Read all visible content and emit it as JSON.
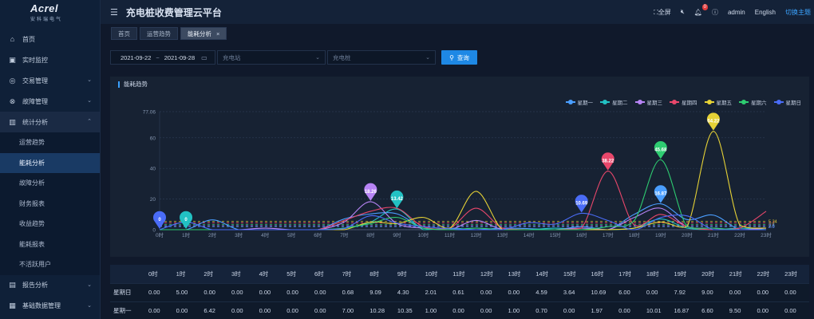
{
  "sidebar": {
    "logo_brand": "Acrel",
    "logo_sub": "安科瑞电气",
    "items": [
      {
        "label": "首页",
        "icon": "home-icon"
      },
      {
        "label": "实时监控",
        "icon": "monitor-icon"
      },
      {
        "label": "交易管理",
        "icon": "trade-icon"
      },
      {
        "label": "故障管理",
        "icon": "fault-icon"
      },
      {
        "label": "统计分析",
        "icon": "stats-icon"
      }
    ],
    "sub_items": [
      "运营趋势",
      "能耗分析",
      "故障分析",
      "财务报表",
      "收益趋势",
      "能耗报表",
      "不活跃用户"
    ],
    "bottom_items": [
      {
        "label": "报告分析",
        "icon": "report-icon"
      },
      {
        "label": "基础数据管理",
        "icon": "database-icon"
      }
    ]
  },
  "topbar": {
    "title": "充电桩收费管理云平台",
    "fullscreen": "全屏",
    "notification_count": "0",
    "user": "admin",
    "language": "English",
    "theme_switch": "切换主题"
  },
  "tabs": [
    "首页",
    "运营趋势",
    "能耗分析"
  ],
  "filters": {
    "date_start": "2021-09-22",
    "date_sep": "~",
    "date_end": "2021-09-28",
    "station_placeholder": "充电站",
    "pile_placeholder": "充电桩",
    "query_label": "查询"
  },
  "chart_data": {
    "type": "line",
    "title": "能耗趋势",
    "ylim": [
      0,
      77.06
    ],
    "yticks": [
      "77.06",
      "60",
      "40",
      "20",
      "0"
    ],
    "categories": [
      "0时",
      "1时",
      "2时",
      "3时",
      "4时",
      "5时",
      "6时",
      "7时",
      "8时",
      "9时",
      "10时",
      "11时",
      "12时",
      "13时",
      "14时",
      "15时",
      "16时",
      "17时",
      "18时",
      "19时",
      "20时",
      "21时",
      "22时",
      "23时"
    ],
    "series": [
      {
        "name": "星期一",
        "color": "#4a9eff",
        "values": [
          0,
          0,
          6.42,
          0,
          0,
          0,
          0,
          7.0,
          10.28,
          10.35,
          1.0,
          0,
          0,
          1.0,
          0.7,
          0,
          1.97,
          0,
          10.01,
          16.87,
          6.6,
          9.5,
          0,
          0
        ]
      },
      {
        "name": "星期二",
        "color": "#22c1c3",
        "values": [
          0,
          0,
          0,
          0,
          0,
          0,
          0,
          1.0,
          5.0,
          13.42,
          0,
          1.0,
          0,
          0,
          0,
          1.0,
          0,
          0,
          1.0,
          7.0,
          1.0,
          0,
          1.0,
          0
        ]
      },
      {
        "name": "星期三",
        "color": "#b784f5",
        "values": [
          0,
          0,
          0,
          0,
          1.0,
          0,
          0,
          5.0,
          18.26,
          4.0,
          1.0,
          0,
          6.0,
          0,
          0,
          0,
          1.0,
          0,
          8.0,
          14.0,
          2.0,
          1.0,
          0,
          1.0
        ]
      },
      {
        "name": "星期四",
        "color": "#e8476b",
        "values": [
          0,
          0,
          0,
          0,
          0,
          0,
          0,
          6.0,
          12.0,
          14.0,
          2.0,
          1.0,
          14.0,
          1.0,
          0,
          0,
          1.0,
          38.22,
          3.0,
          10.0,
          2.0,
          0,
          1.0,
          12.0
        ]
      },
      {
        "name": "星期五",
        "color": "#e6d236",
        "values": [
          0,
          0,
          0,
          0,
          0,
          0,
          0,
          0,
          5.0,
          4.0,
          8.0,
          1.0,
          25.0,
          0,
          0,
          0,
          0,
          0,
          1.0,
          5.0,
          2.0,
          64.22,
          3.0,
          1.0
        ]
      },
      {
        "name": "星期六",
        "color": "#2ecc71",
        "values": [
          0,
          0,
          0,
          0,
          0,
          0,
          0,
          1.0,
          4.0,
          8.0,
          1.0,
          0,
          1.0,
          0,
          0,
          0,
          0,
          2.0,
          6.0,
          45.68,
          2.0,
          1.0,
          0,
          0
        ]
      },
      {
        "name": "星期日",
        "color": "#4a6cf7",
        "values": [
          0,
          5.0,
          0,
          0,
          0,
          0,
          0,
          0.68,
          9.09,
          4.3,
          2.01,
          0.61,
          0,
          0,
          4.59,
          3.64,
          10.69,
          6.0,
          0,
          7.92,
          9.0,
          0,
          0,
          0
        ]
      }
    ],
    "markers": [
      {
        "series": 6,
        "index": 0,
        "label": "0"
      },
      {
        "series": 1,
        "index": 1,
        "label": "0"
      },
      {
        "series": 2,
        "index": 8,
        "label": "18.26"
      },
      {
        "series": 1,
        "index": 9,
        "label": "13.42"
      },
      {
        "series": 6,
        "index": 16,
        "label": "10.69"
      },
      {
        "series": 3,
        "index": 17,
        "label": "38.22"
      },
      {
        "series": 5,
        "index": 19,
        "label": "45.68"
      },
      {
        "series": 0,
        "index": 19,
        "label": "16.87"
      },
      {
        "series": 4,
        "index": 21,
        "label": "64.22"
      }
    ],
    "avg_lines": [
      {
        "color": "#e6d236",
        "value": 5.34,
        "label": "5.34"
      },
      {
        "color": "#e8476b",
        "value": 4.4,
        "label": "4.4"
      },
      {
        "color": "#2ecc71",
        "value": 3.4,
        "label": "3.4"
      },
      {
        "color": "#b784f5",
        "value": 2.6,
        "label": "2.6"
      },
      {
        "color": "#4a9eff",
        "value": 2.0,
        "label": "2.0"
      }
    ]
  },
  "table": {
    "headers": [
      "",
      "0时",
      "1时",
      "2时",
      "3时",
      "4时",
      "5时",
      "6时",
      "7时",
      "8时",
      "9时",
      "10时",
      "11时",
      "12时",
      "13时",
      "14时",
      "15时",
      "16时",
      "17时",
      "18时",
      "19时",
      "20时",
      "21时",
      "22时",
      "23时"
    ],
    "rows": [
      [
        "星期日",
        "0.00",
        "5.00",
        "0.00",
        "0.00",
        "0.00",
        "0.00",
        "0.00",
        "0.68",
        "9.09",
        "4.30",
        "2.01",
        "0.61",
        "0.00",
        "0.00",
        "4.59",
        "3.64",
        "10.69",
        "6.00",
        "0.00",
        "7.92",
        "9.00",
        "0.00",
        "0.00",
        "0.00"
      ],
      [
        "星期一",
        "0.00",
        "0.00",
        "6.42",
        "0.00",
        "0.00",
        "0.00",
        "0.00",
        "7.00",
        "10.28",
        "10.35",
        "1.00",
        "0.00",
        "0.00",
        "1.00",
        "0.70",
        "0.00",
        "1.97",
        "0.00",
        "10.01",
        "16.87",
        "6.60",
        "9.50",
        "0.00",
        "0.00"
      ]
    ]
  }
}
